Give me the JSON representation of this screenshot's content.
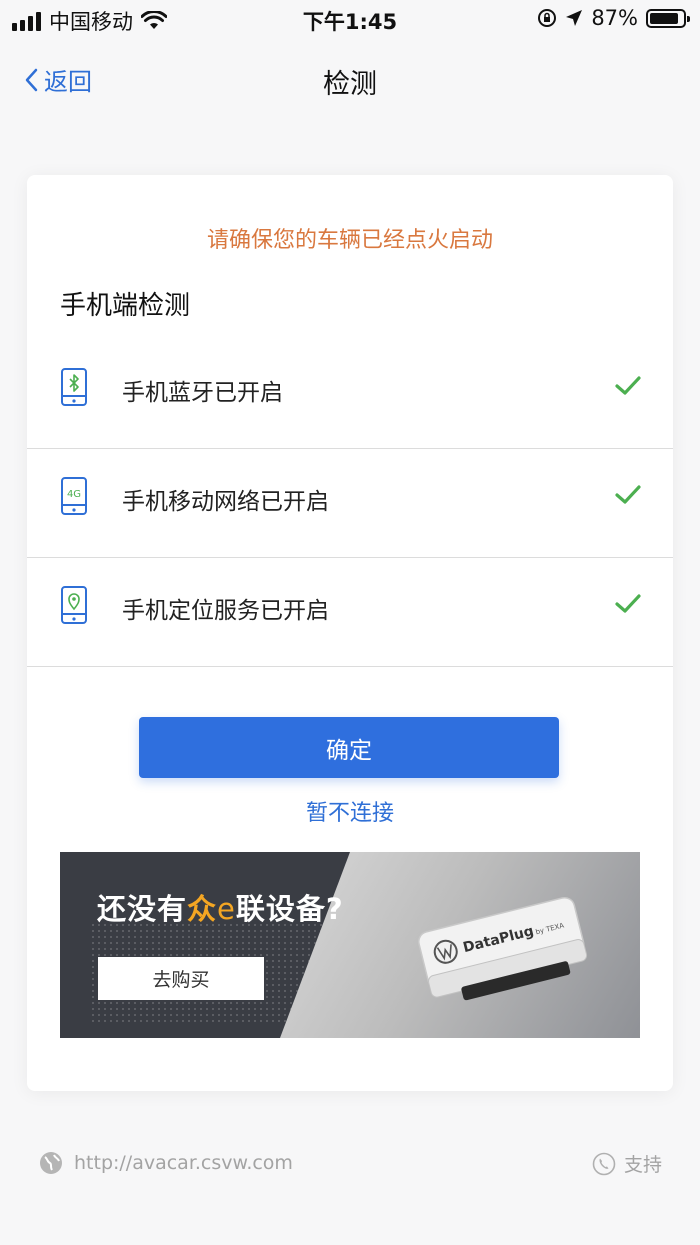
{
  "status_bar": {
    "carrier": "中国移动",
    "time": "下午1:45",
    "battery_percent": "87%",
    "battery_level": 0.87,
    "icons": [
      "signal-icon",
      "wifi-icon",
      "orientation-lock-icon",
      "location-arrow-icon",
      "battery-icon"
    ]
  },
  "nav": {
    "back_label": "返回",
    "title": "检测"
  },
  "card": {
    "notice": "请确保您的车辆已经点火启动",
    "section_title": "手机端检测",
    "checks": [
      {
        "icon": "phone-bluetooth-icon",
        "label": "手机蓝牙已开启",
        "status": "checked"
      },
      {
        "icon": "phone-4g-icon",
        "label": "手机移动网络已开启",
        "status": "checked"
      },
      {
        "icon": "phone-location-icon",
        "label": "手机定位服务已开启",
        "status": "checked"
      }
    ],
    "confirm_label": "确定",
    "skip_label": "暂不连接"
  },
  "banner": {
    "text_prefix": "还没有",
    "brand_zhong": "众",
    "brand_e": "e",
    "brand_lian": "联",
    "text_suffix": "设备?",
    "buy_label": "去购买",
    "device_label": "DataPlug",
    "device_sub": "by TEXA"
  },
  "footer": {
    "url": "http://avacar.csvw.com",
    "support_label": "支持"
  },
  "colors": {
    "accent": "#2f6fde",
    "notice": "#d9783f",
    "check": "#4caf50",
    "banner_highlight": "#f4a623"
  }
}
